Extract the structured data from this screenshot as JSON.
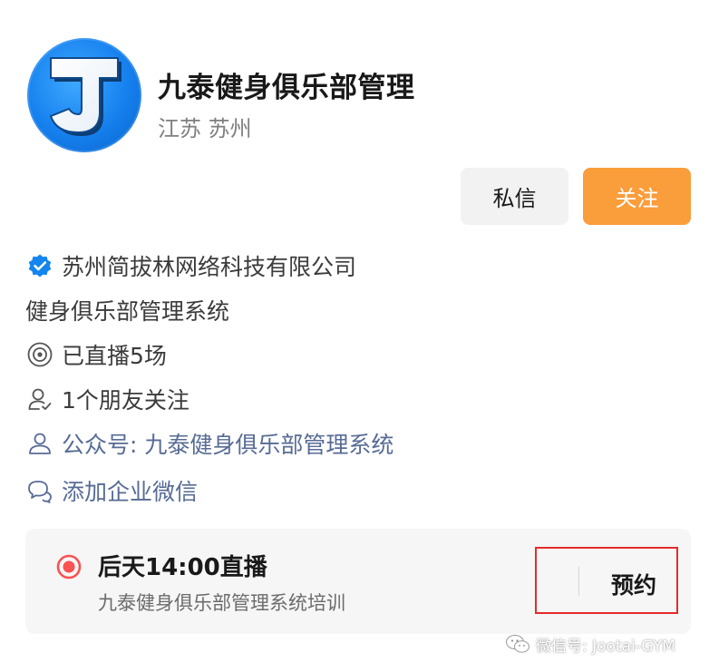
{
  "profile": {
    "avatar_letter": "J",
    "name": "九泰健身俱乐部管理",
    "region": "江苏 苏州"
  },
  "actions": {
    "message_label": "私信",
    "follow_label": "关注",
    "follow_color": "#fa9d3b"
  },
  "info": {
    "company": "苏州简拔林网络科技有限公司",
    "description": "健身俱乐部管理系统",
    "live_count": "已直播5场",
    "friends_following": "1个朋友关注",
    "official_account": "公众号: 九泰健身俱乐部管理系统",
    "add_wecom": "添加企业微信"
  },
  "live": {
    "time_title": "后天14:00直播",
    "subtitle": "九泰健身俱乐部管理系统培训",
    "reserve_label": "预约",
    "dot_color": "#fa5151"
  },
  "watermark": {
    "text": "微信号: Jootai-GYM"
  },
  "icons": {
    "verified": "verified-badge-icon",
    "live": "live-target-icon",
    "friends": "person-add-icon",
    "account": "person-icon",
    "wecom": "chat-bubbles-icon",
    "live_dot": "live-dot-icon"
  }
}
